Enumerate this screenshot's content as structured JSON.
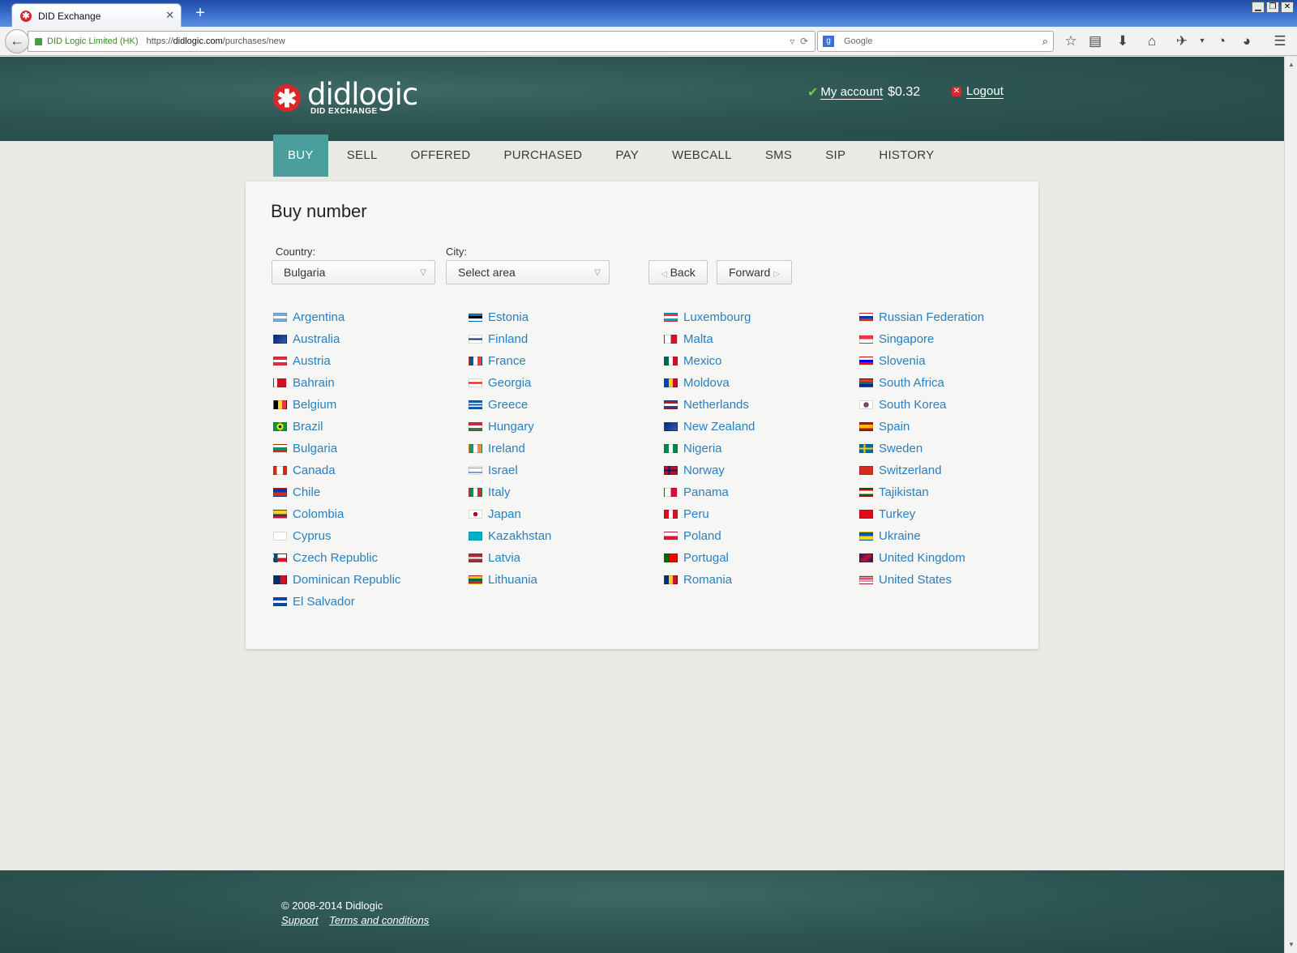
{
  "browser": {
    "tab_title": "DID Exchange",
    "new_tab": "+",
    "tab_close": "✕",
    "identity": "DID Logic Limited (HK)",
    "url_prefix": "https://",
    "url_domain": "didlogic.com",
    "url_path": "/purchases/new",
    "search_placeholder": "Google"
  },
  "header": {
    "logo_name": "didlogic",
    "logo_subtitle": "DID EXCHANGE",
    "account_label": "My account",
    "balance": "$0.32",
    "logout_label": "Logout"
  },
  "menu": [
    "BUY",
    "SELL",
    "OFFERED",
    "PURCHASED",
    "PAY",
    "WEBCALL",
    "SMS",
    "SIP",
    "HISTORY"
  ],
  "panel": {
    "title": "Buy number",
    "country_label": "Country:",
    "country_value": "Bulgaria",
    "city_label": "City:",
    "city_value": "Select area",
    "back_label": "Back",
    "forward_label": "Forward"
  },
  "countries": [
    [
      "Argentina",
      "Australia",
      "Austria",
      "Bahrain",
      "Belgium",
      "Brazil",
      "Bulgaria",
      "Canada",
      "Chile",
      "Colombia",
      "Cyprus",
      "Czech Republic",
      "Dominican Republic",
      "El Salvador"
    ],
    [
      "Estonia",
      "Finland",
      "France",
      "Georgia",
      "Greece",
      "Hungary",
      "Ireland",
      "Israel",
      "Italy",
      "Japan",
      "Kazakhstan",
      "Latvia",
      "Lithuania"
    ],
    [
      "Luxembourg",
      "Malta",
      "Mexico",
      "Moldova",
      "Netherlands",
      "New Zealand",
      "Nigeria",
      "Norway",
      "Panama",
      "Peru",
      "Poland",
      "Portugal",
      "Romania"
    ],
    [
      "Russian Federation",
      "Singapore",
      "Slovenia",
      "South Africa",
      "South Korea",
      "Spain",
      "Sweden",
      "Switzerland",
      "Tajikistan",
      "Turkey",
      "Ukraine",
      "United Kingdom",
      "United States"
    ]
  ],
  "footer": {
    "copyright": "© 2008-2014 Didlogic",
    "support": "Support",
    "terms": "Terms and conditions"
  },
  "colors": {
    "accent": "#4a9f9c",
    "header_bg": "#2d5552",
    "link": "#2a7fc0",
    "brand_red": "#d9262a"
  }
}
